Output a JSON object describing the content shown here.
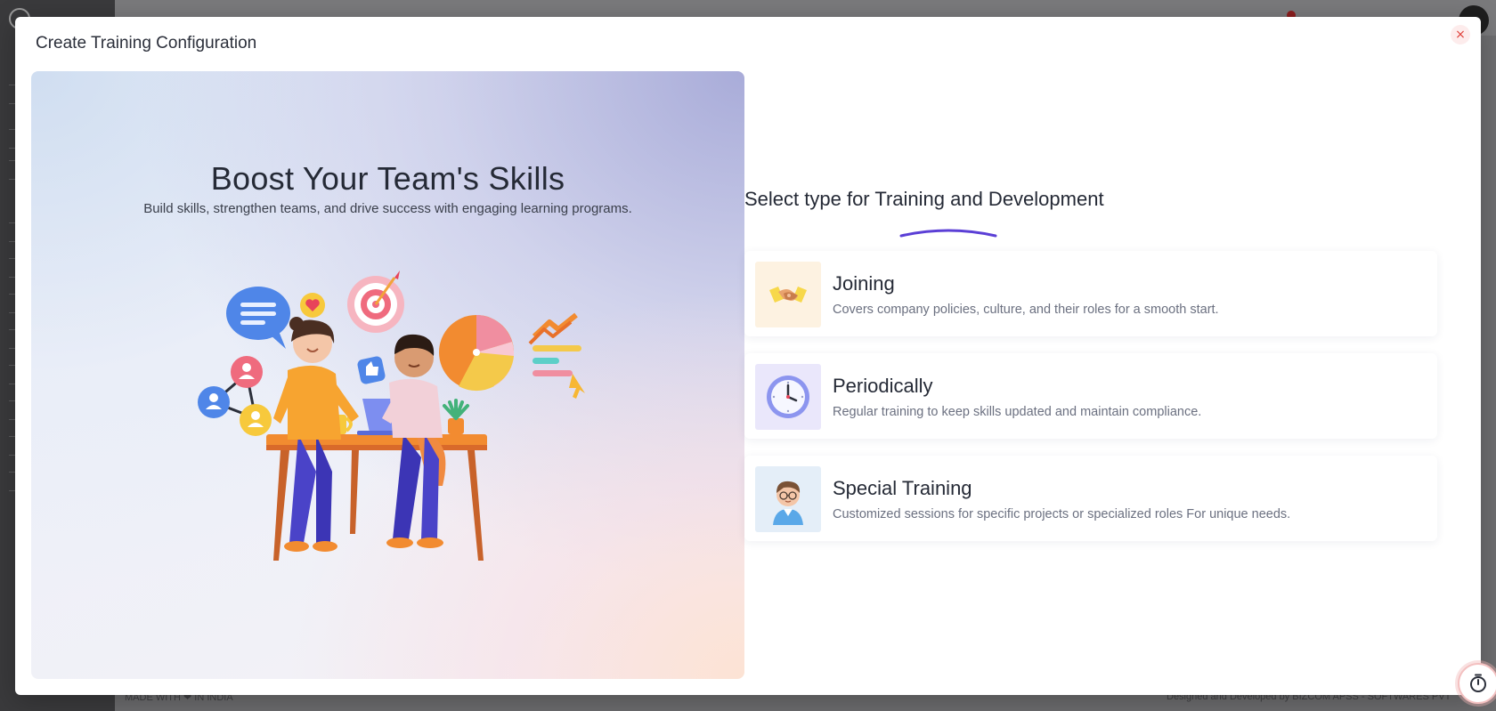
{
  "modal": {
    "title": "Create Training Configuration",
    "close_label": "×"
  },
  "hero": {
    "title": "Boost Your Team's Skills",
    "subtitle": "Build skills, strengthen teams, and drive success with engaging learning programs."
  },
  "selector": {
    "title": "Select type for Training and Development",
    "options": [
      {
        "title": "Joining",
        "description": "Covers company policies, culture, and their roles for a smooth start.",
        "icon": "handshake-icon",
        "thumb_bg": "#fdf2e1"
      },
      {
        "title": "Periodically",
        "description": "Regular training to keep skills updated and maintain compliance.",
        "icon": "clock-icon",
        "thumb_bg": "#eae7fb"
      },
      {
        "title": "Special Training",
        "description": "Customized sessions for specific projects or specialized roles For unique needs.",
        "icon": "person-avatar-icon",
        "thumb_bg": "#e4eef8"
      }
    ]
  },
  "colors": {
    "accent_underline": "#5b3fd6",
    "close_red": "#e0413b"
  },
  "background_app": {
    "footer_left": "MADE WITH ❤ IN INDIA",
    "footer_right": "Designed and Developed by BIZCOM APSS - SOFTWARES PVT"
  }
}
